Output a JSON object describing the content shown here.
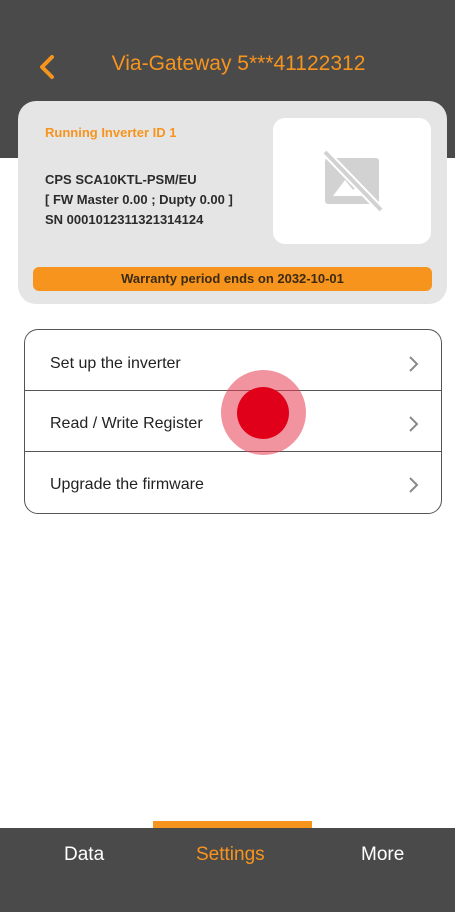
{
  "header": {
    "title": "Via-Gateway 5***41122312",
    "back_icon": "chevron-left-icon"
  },
  "inverter": {
    "running_id": "Running Inverter ID 1",
    "model": "CPS SCA10KTL-PSM/EU",
    "firmware": "[ FW Master 0.00 ; Dupty 0.00 ]",
    "serial": "SN 0001012311321314124",
    "image_icon": "image-unavailable-icon",
    "warranty": "Warranty period ends on 2032-10-01"
  },
  "menu": {
    "items": [
      {
        "label": "Set up the inverter"
      },
      {
        "label": "Read / Write Register"
      },
      {
        "label": "Upgrade the firmware"
      }
    ]
  },
  "tabs": {
    "items": [
      {
        "label": "Data"
      },
      {
        "label": "Settings"
      },
      {
        "label": "More"
      }
    ],
    "active": "Settings"
  },
  "colors": {
    "accent": "#f7941d",
    "bar": "#4a4a4a",
    "card": "#e5e5e5",
    "touch": "#e0001a"
  }
}
